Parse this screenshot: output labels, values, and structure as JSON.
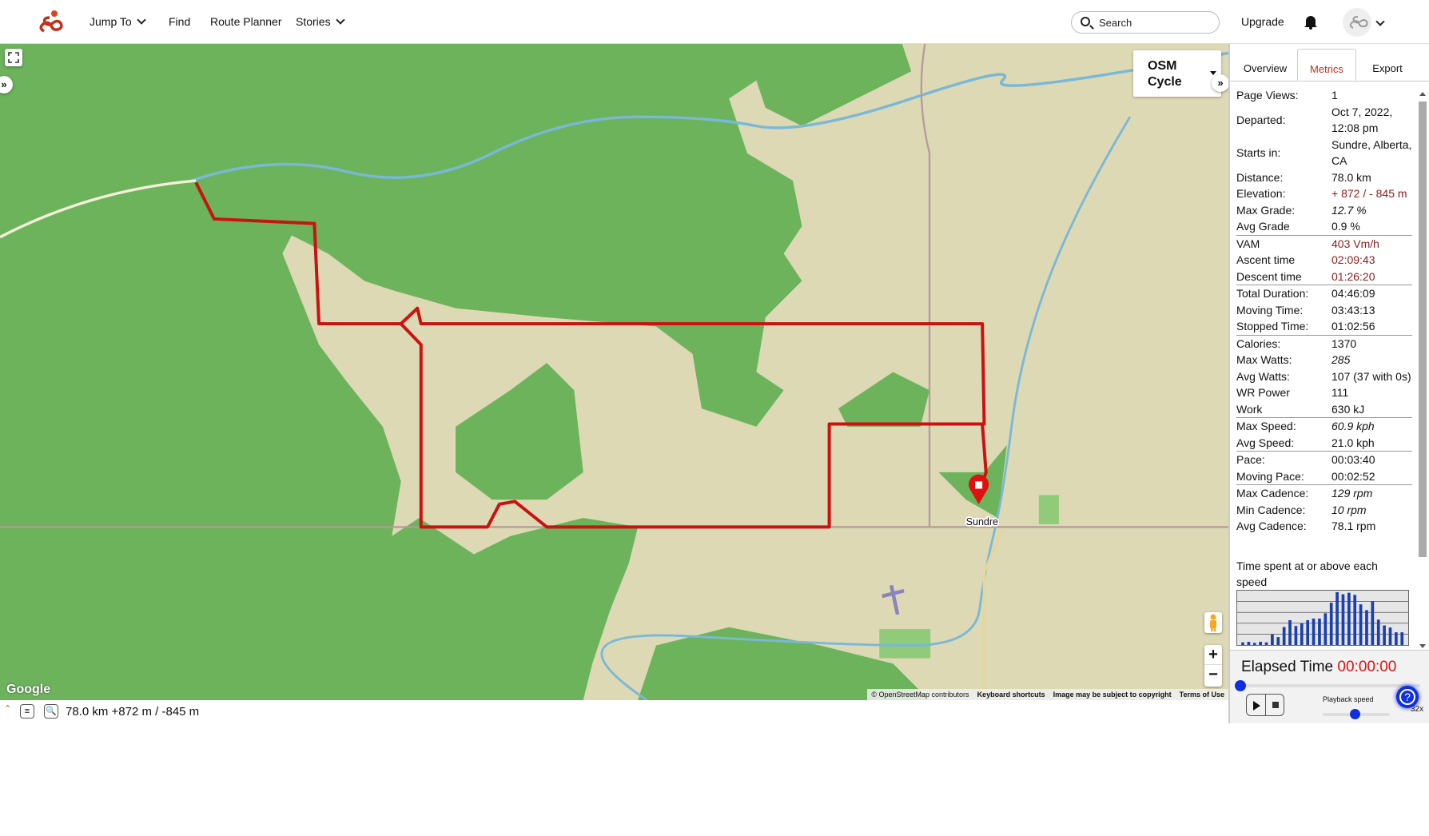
{
  "header": {
    "nav": [
      {
        "label": "Jump To",
        "dropdown": true
      },
      {
        "label": "Find"
      },
      {
        "label": "Route Planner"
      },
      {
        "label": "Stories",
        "dropdown": true
      }
    ],
    "search_placeholder": "Search",
    "upgrade": "Upgrade",
    "brand_color": "#e0401c"
  },
  "map": {
    "layer": "OSM",
    "layer2": "Cycle",
    "place": "Sundre",
    "google": "Google",
    "attribution": [
      "© OpenStreetMap contributors",
      "Keyboard shortcuts",
      "Image may be subject to copyright",
      "Terms of Use"
    ],
    "route_color": "#cc1111",
    "zoom_in": "+",
    "zoom_out": "−"
  },
  "status": {
    "summary": "78.0 km +872 m / -845 m"
  },
  "panel": {
    "tabs": [
      "Overview",
      "Metrics",
      "Export"
    ],
    "active_tab": "Metrics",
    "rows": [
      {
        "label": "Page Views:",
        "value": "1"
      },
      {
        "label": "Departed:",
        "value": "Oct 7, 2022, 12:08 pm"
      },
      {
        "label": "Starts in:",
        "value": "Sundre, Alberta, CA"
      },
      {
        "label": "Distance:",
        "value": "78.0 km"
      },
      {
        "label": "Elevation:",
        "value": "+ 872 / - 845 m",
        "style": "red"
      },
      {
        "label": "Max Grade:",
        "value": "12.7 %",
        "style": "it"
      },
      {
        "label": "Avg Grade",
        "value": "0.9 %"
      },
      {
        "label": "VAM",
        "value": "403 Vm/h",
        "style": "red",
        "sep": true
      },
      {
        "label": "Ascent time",
        "value": "02:09:43",
        "style": "red"
      },
      {
        "label": "Descent time",
        "value": "01:26:20",
        "style": "red"
      },
      {
        "label": "Total Duration:",
        "value": "04:46:09",
        "sep": true
      },
      {
        "label": "Moving Time:",
        "value": "03:43:13"
      },
      {
        "label": "Stopped Time:",
        "value": "01:02:56"
      },
      {
        "label": "Calories:",
        "value": "1370",
        "sep": true
      },
      {
        "label": "Max Watts:",
        "value": "285",
        "style": "it"
      },
      {
        "label": "Avg Watts:",
        "value": "107 (37 with 0s)"
      },
      {
        "label": "WR Power",
        "value": "111"
      },
      {
        "label": "Work",
        "value": "630 kJ"
      },
      {
        "label": "Max Speed:",
        "value": "60.9 kph",
        "style": "it",
        "sep": true
      },
      {
        "label": "Avg Speed:",
        "value": "21.0 kph"
      },
      {
        "label": "Pace:",
        "value": "00:03:40",
        "sep": true
      },
      {
        "label": "Moving Pace:",
        "value": "00:02:52"
      },
      {
        "label": "Max Cadence:",
        "value": "129 rpm",
        "style": "it",
        "sep": true
      },
      {
        "label": "Min Cadence:",
        "value": "10 rpm",
        "style": "it"
      },
      {
        "label": "Avg Cadence:",
        "value": "78.1 rpm"
      }
    ],
    "hist_title": "Time spent at or above each speed",
    "player": {
      "label": "Elapsed Time",
      "time": "00:00:00",
      "speed_label": "Playback speed",
      "speed": "32x",
      "progress": 0
    }
  },
  "chart_data": {
    "type": "bar",
    "title": "Time spent at or above each speed",
    "color": "#1a3fb0",
    "values": [
      0.05,
      0.06,
      0.04,
      0.06,
      0.05,
      0.2,
      0.15,
      0.34,
      0.47,
      0.36,
      0.41,
      0.47,
      0.5,
      0.5,
      0.6,
      0.8,
      1.0,
      0.96,
      0.99,
      0.95,
      0.77,
      0.66,
      0.83,
      0.48,
      0.37,
      0.33,
      0.24,
      0.24
    ],
    "ylim": [
      0,
      1
    ],
    "grid": true
  }
}
